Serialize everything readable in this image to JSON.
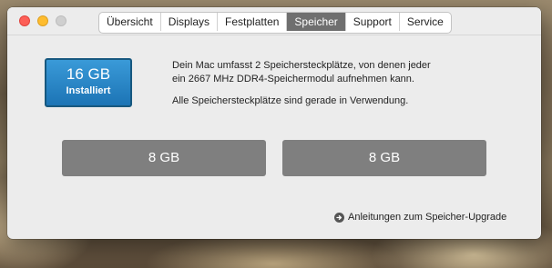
{
  "window": {
    "tabs": [
      {
        "label": "Übersicht"
      },
      {
        "label": "Displays"
      },
      {
        "label": "Festplatten"
      },
      {
        "label": "Speicher",
        "active": true
      },
      {
        "label": "Support"
      },
      {
        "label": "Service"
      }
    ]
  },
  "memory": {
    "size": "16 GB",
    "status": "Installiert",
    "description_line1": "Dein Mac umfasst 2 Speichersteckplätze, von denen jeder",
    "description_line2": "ein 2667 MHz DDR4-Speichermodul aufnehmen kann.",
    "description_line3": "Alle Speichersteckplätze sind gerade in Verwendung.",
    "slots": [
      {
        "label": "8 GB"
      },
      {
        "label": "8 GB"
      }
    ],
    "upgrade_link": "Anleitungen zum Speicher-Upgrade"
  },
  "colors": {
    "badge": "#1c74b5",
    "slot": "#7f7f7f",
    "active_tab": "#6f6f6f"
  },
  "icons": {
    "close": "close-window-icon",
    "minimize": "minimize-window-icon",
    "maximize": "maximize-window-icon",
    "link": "arrow-circle-right-icon"
  }
}
